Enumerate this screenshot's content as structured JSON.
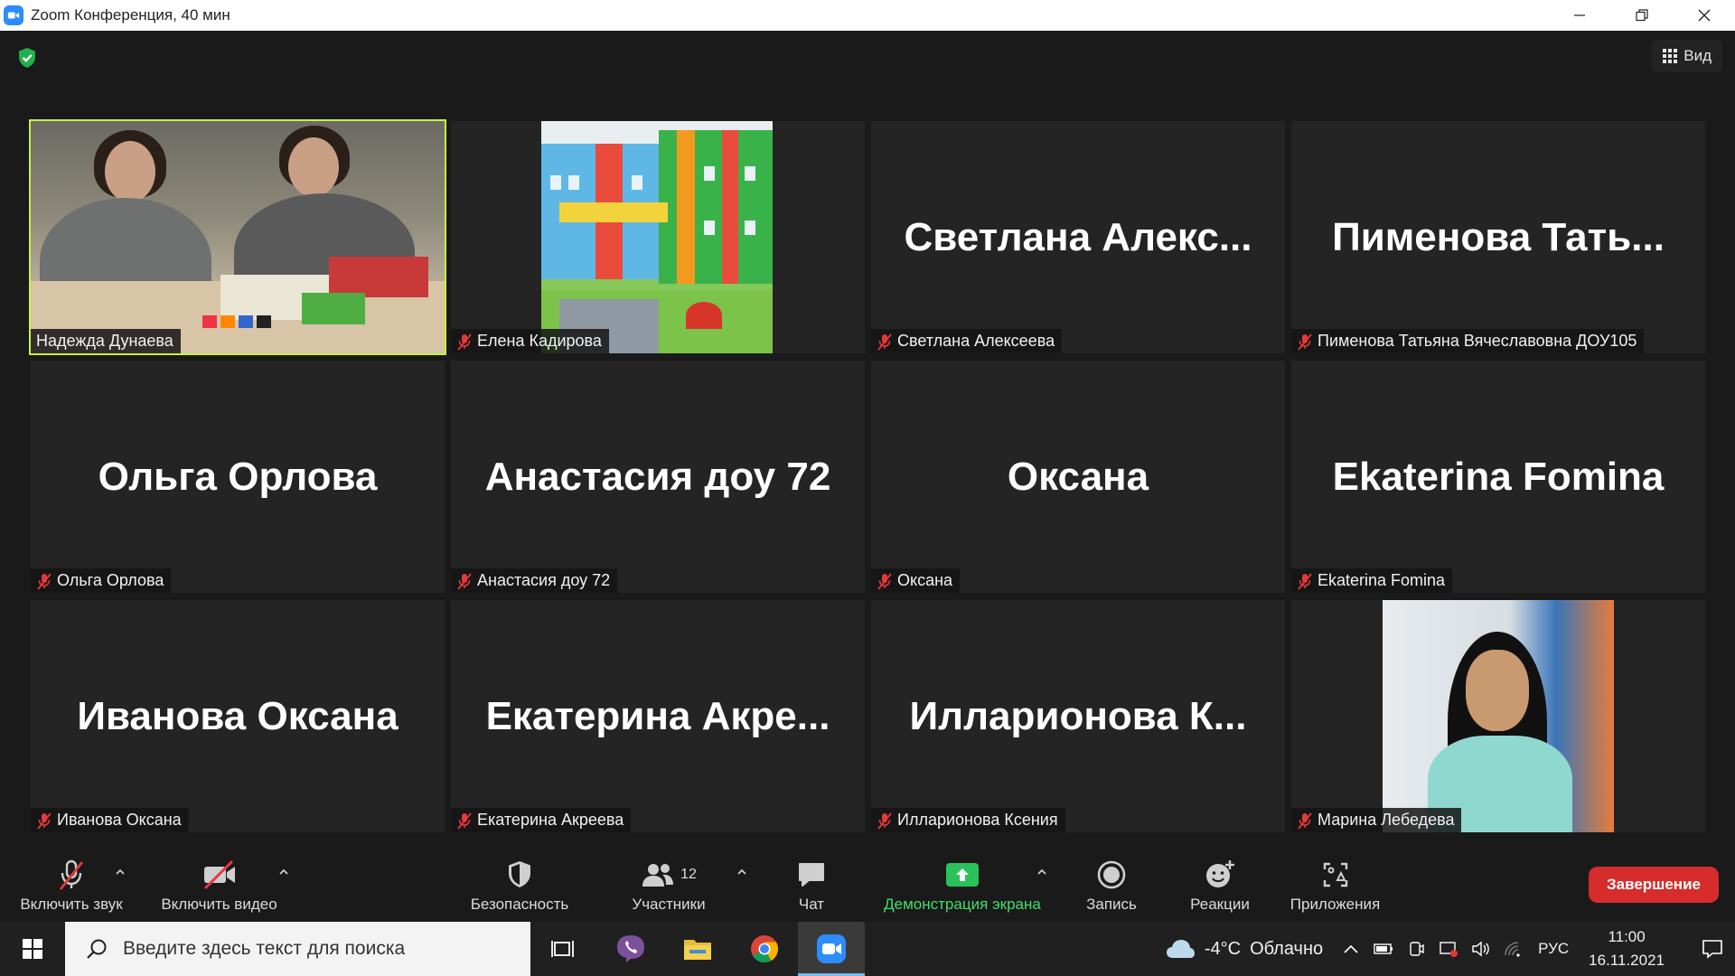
{
  "window": {
    "title": "Zoom Конференция, 40 мин"
  },
  "meeting": {
    "view_label": "Вид",
    "tiles": [
      {
        "name": "Надежда Дунаева",
        "big": "",
        "muted": false,
        "kind": "video-classroom",
        "active": true
      },
      {
        "name": "Елена Кадирова",
        "big": "",
        "muted": true,
        "kind": "photo-school",
        "active": false
      },
      {
        "name": "Светлана Алексеева",
        "big": "Светлана  Алекс...",
        "muted": true,
        "kind": "name",
        "active": false
      },
      {
        "name": "Пименова Татьяна Вячеславовна ДОУ105",
        "big": "Пименова  Тать...",
        "muted": true,
        "kind": "name",
        "active": false
      },
      {
        "name": "Ольга Орлова",
        "big": "Ольга Орлова",
        "muted": true,
        "kind": "name",
        "active": false
      },
      {
        "name": "Анастасия доу 72",
        "big": "Анастасия доу 72",
        "muted": true,
        "kind": "name",
        "active": false
      },
      {
        "name": "Оксана",
        "big": "Оксана",
        "muted": true,
        "kind": "name",
        "active": false
      },
      {
        "name": "Ekaterina Fomina",
        "big": "Ekaterina Fomina",
        "muted": true,
        "kind": "name",
        "active": false
      },
      {
        "name": "Иванова Оксана",
        "big": "Иванова Оксана",
        "muted": true,
        "kind": "name",
        "active": false
      },
      {
        "name": "Екатерина Акреева",
        "big": "Екатерина  Акре...",
        "muted": true,
        "kind": "name",
        "active": false
      },
      {
        "name": "Илларионова Ксения",
        "big": "Илларионова  К...",
        "muted": true,
        "kind": "name",
        "active": false
      },
      {
        "name": "Марина Лебедева",
        "big": "",
        "muted": true,
        "kind": "photo-portrait",
        "active": false
      }
    ]
  },
  "toolbar": {
    "audio_label": "Включить звук",
    "video_label": "Включить видео",
    "security_label": "Безопасность",
    "participants_label": "Участники",
    "participants_count": "12",
    "chat_label": "Чат",
    "share_label": "Демонстрация экрана",
    "record_label": "Запись",
    "reactions_label": "Реакции",
    "apps_label": "Приложения",
    "end_label": "Завершение"
  },
  "taskbar": {
    "search_placeholder": "Введите здесь текст для поиска",
    "weather_temp": "-4°C",
    "weather_text": "Облачно",
    "lang": "РУС",
    "time": "11:00",
    "date": "16.11.2021"
  },
  "colors": {
    "active_speaker": "#c9f23b",
    "share_green": "#3fe06a",
    "end_red": "#d62c2c",
    "zoom_blue": "#2d8cff"
  }
}
